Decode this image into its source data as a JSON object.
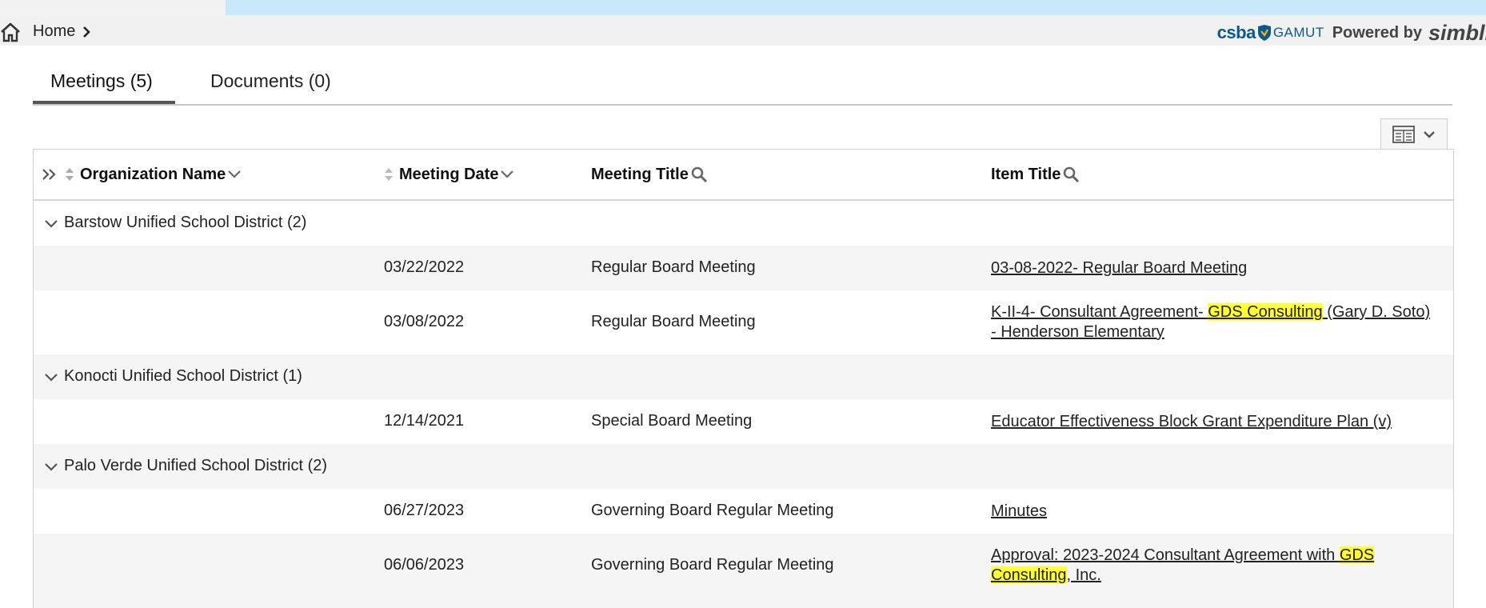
{
  "breadcrumb": {
    "home_label": "Home"
  },
  "branding": {
    "csba": "csba",
    "gamut": "GAMUT",
    "powered_by": "Powered by",
    "product": "simbli"
  },
  "tabs": [
    {
      "label": "Meetings (5)",
      "active": true
    },
    {
      "label": "Documents (0)",
      "active": false
    }
  ],
  "grid": {
    "columns": [
      "Organization Name",
      "Meeting Date",
      "Meeting Title",
      "Item Title"
    ],
    "groups": [
      {
        "label": "Barstow Unified School District (2)",
        "expanded": true
      },
      {
        "label": "Konocti Unified School District (1)",
        "expanded": true
      },
      {
        "label": "Palo Verde Unified School District (2)",
        "expanded": true
      }
    ],
    "rows": [
      {
        "date": "03/22/2022",
        "title": "Regular Board Meeting",
        "item": "03-08-2022- Regular Board Meeting"
      },
      {
        "date": "03/08/2022",
        "title": "Regular Board Meeting",
        "item_parts": [
          "K-II-4- Consultant Agreement- ",
          "GDS Consulting",
          " (Gary D. Soto)",
          "- Henderson Elementary"
        ]
      },
      {
        "date": "12/14/2021",
        "title": "Special Board Meeting",
        "item": "Educator Effectiveness Block Grant Expenditure Plan (v)"
      },
      {
        "date": "06/27/2023",
        "title": "Governing Board Regular Meeting",
        "item": "Minutes"
      },
      {
        "date": "06/06/2023",
        "title": "Governing Board Regular Meeting",
        "item_parts": [
          "Approval: 2023-2024 Consultant Agreement with ",
          "GDS",
          "Consulting",
          ", Inc."
        ]
      }
    ]
  },
  "colors": {
    "highlight": "#ffff33",
    "top_strip": "#c9e8f8",
    "brand_blue": "#0b5a8c"
  },
  "icons": [
    "home-icon",
    "chevron-right-icon",
    "column-chooser-icon",
    "expand-all-icon",
    "sort-icon",
    "chevron-down-icon",
    "search-icon"
  ]
}
